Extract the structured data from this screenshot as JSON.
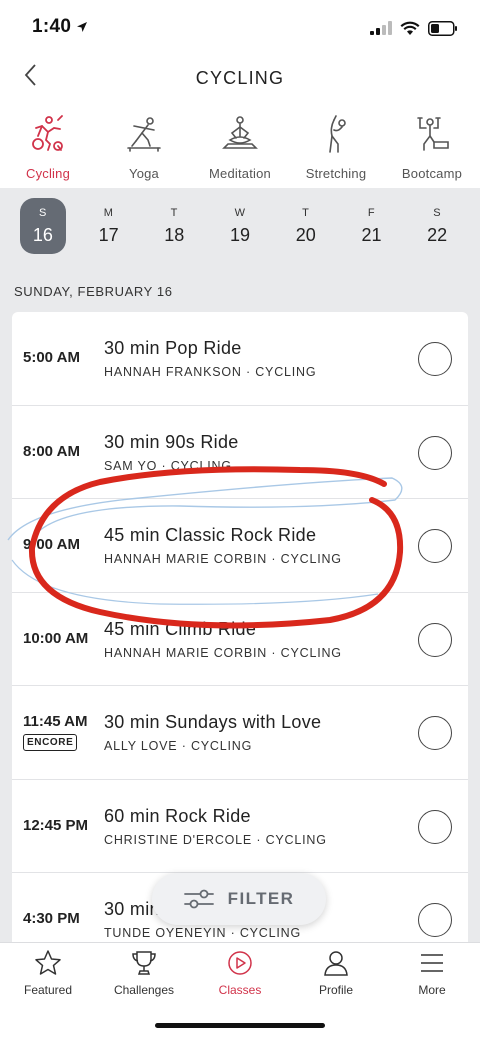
{
  "status_bar": {
    "time": "1:40"
  },
  "header": {
    "title": "CYCLING"
  },
  "categories": [
    {
      "label": "Cycling",
      "icon": "cycling-icon",
      "active": true
    },
    {
      "label": "Yoga",
      "icon": "yoga-icon",
      "active": false
    },
    {
      "label": "Meditation",
      "icon": "meditation-icon",
      "active": false
    },
    {
      "label": "Stretching",
      "icon": "stretching-icon",
      "active": false
    },
    {
      "label": "Bootcamp",
      "icon": "bootcamp-icon",
      "active": false
    }
  ],
  "days": [
    {
      "letter": "S",
      "num": "16",
      "selected": true
    },
    {
      "letter": "M",
      "num": "17",
      "selected": false
    },
    {
      "letter": "T",
      "num": "18",
      "selected": false
    },
    {
      "letter": "W",
      "num": "19",
      "selected": false
    },
    {
      "letter": "T",
      "num": "20",
      "selected": false
    },
    {
      "letter": "F",
      "num": "21",
      "selected": false
    },
    {
      "letter": "S",
      "num": "22",
      "selected": false
    }
  ],
  "schedule": {
    "date_header": "SUNDAY, FEBRUARY 16",
    "classes": [
      {
        "time": "5:00 AM",
        "title": "30 min Pop Ride",
        "instructor": "HANNAH FRANKSON",
        "category": "CYCLING",
        "badge": ""
      },
      {
        "time": "8:00 AM",
        "title": "30 min 90s Ride",
        "instructor": "SAM YO",
        "category": "CYCLING",
        "badge": ""
      },
      {
        "time": "9:00 AM",
        "title": "45 min Classic Rock Ride",
        "instructor": "HANNAH MARIE CORBIN",
        "category": "CYCLING",
        "badge": ""
      },
      {
        "time": "10:00 AM",
        "title": "45 min Climb Ride",
        "instructor": "HANNAH MARIE CORBIN",
        "category": "CYCLING",
        "badge": ""
      },
      {
        "time": "11:45 AM",
        "title": "30 min Sundays with Love",
        "instructor": "ALLY LOVE",
        "category": "CYCLING",
        "badge": "ENCORE"
      },
      {
        "time": "12:45 PM",
        "title": "60 min Rock Ride",
        "instructor": "CHRISTINE D'ERCOLE",
        "category": "CYCLING",
        "badge": ""
      },
      {
        "time": "4:30 PM",
        "title": "30 min",
        "instructor": "TUNDE OYENEYIN",
        "category": "CYCLING",
        "badge": ""
      }
    ]
  },
  "filter": {
    "label": "FILTER"
  },
  "tabs": [
    {
      "label": "Featured",
      "icon": "star-icon",
      "active": false
    },
    {
      "label": "Challenges",
      "icon": "trophy-icon",
      "active": false
    },
    {
      "label": "Classes",
      "icon": "play-circle-icon",
      "active": true
    },
    {
      "label": "Profile",
      "icon": "person-icon",
      "active": false
    },
    {
      "label": "More",
      "icon": "menu-icon",
      "active": false
    }
  ],
  "colors": {
    "accent": "#d1334a",
    "selected_day": "#656b74",
    "background": "#e9eaec",
    "annotation_red": "#d9281c",
    "annotation_blue": "#a9c8e6"
  }
}
